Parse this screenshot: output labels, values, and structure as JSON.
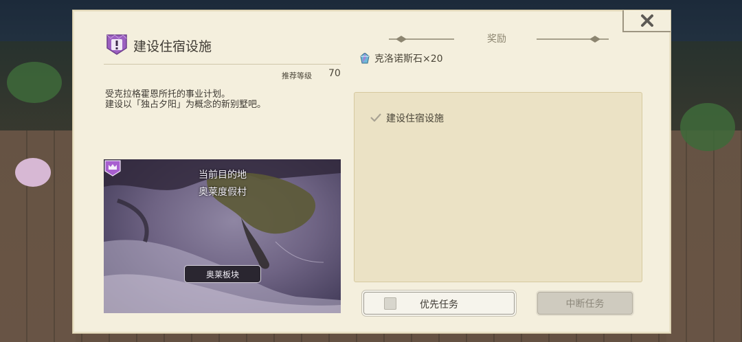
{
  "quest": {
    "title": "建设住宿设施",
    "recommended_level_label": "推荐等级",
    "recommended_level": "70",
    "description_line1": "受克拉格霍恩所托的事业计划。",
    "description_line2": "建设以「独占夕阳」为概念的新别墅吧。"
  },
  "map": {
    "destination_label": "当前目的地",
    "destination_name": "奥莱度假村",
    "region_name": "奥莱板块"
  },
  "rewards": {
    "header": "奖励",
    "item": "克洛诺斯石×20"
  },
  "objectives": [
    {
      "text": "建设住宿设施"
    }
  ],
  "buttons": {
    "priority": "优先任务",
    "abort": "中断任务"
  },
  "icons": {
    "close": "close-x-icon",
    "quest": "quest-exclamation-shield-icon",
    "gem": "chronos-stone-icon",
    "check": "checkmark-icon",
    "marker": "crown-map-marker-icon"
  },
  "colors": {
    "panel_bg": "#f4efdd",
    "objective_bg": "#ebe2c5",
    "quest_badge": "#9b5fc0",
    "text_dark": "#3e3a33"
  }
}
